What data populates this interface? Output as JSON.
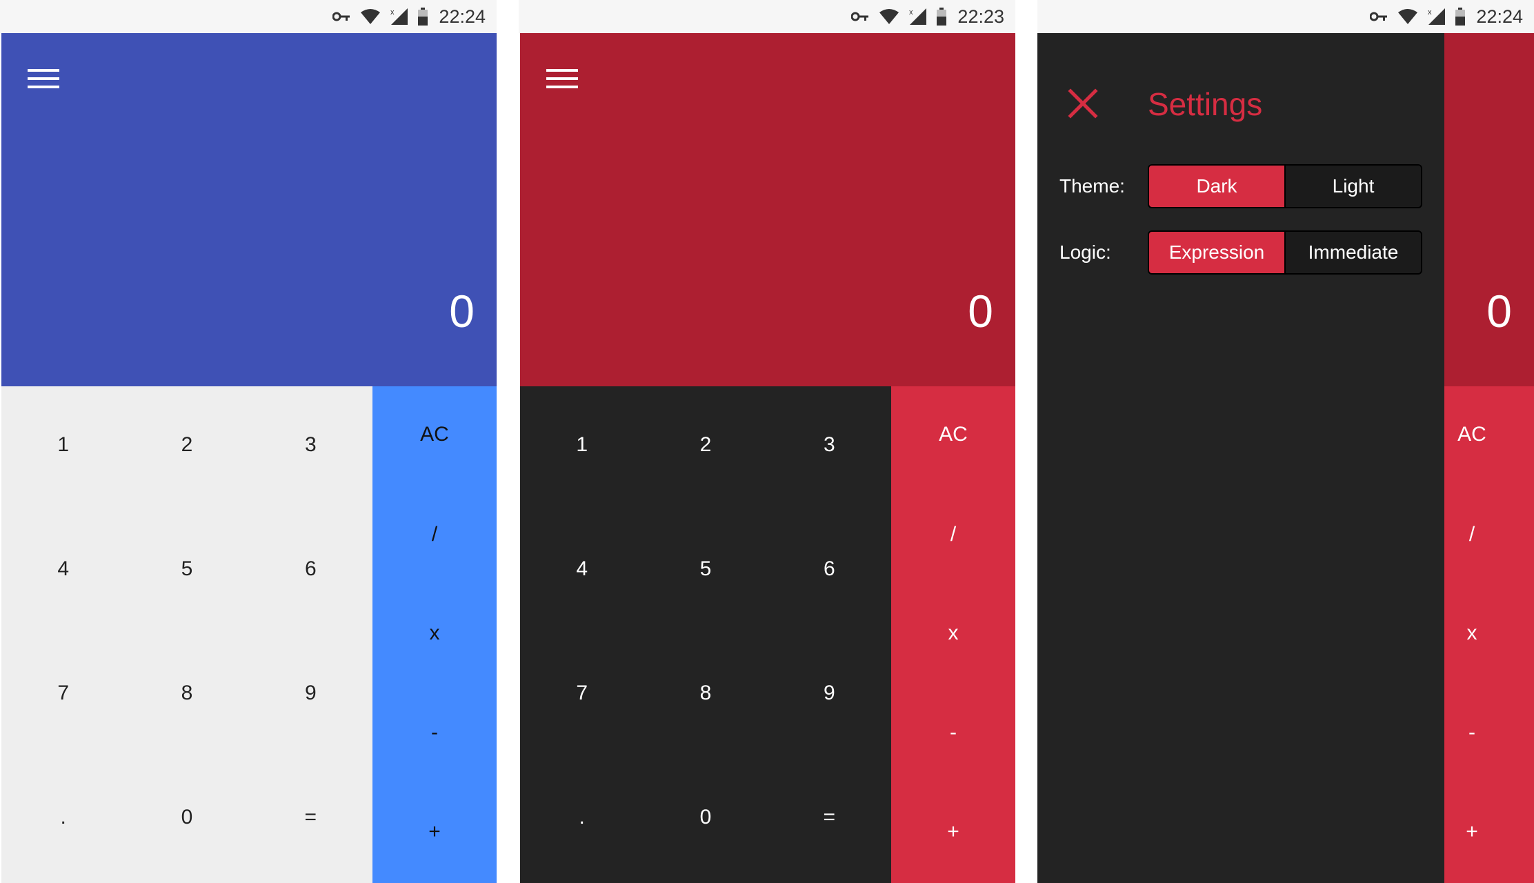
{
  "screens": [
    {
      "status_time": "22:24",
      "display_value": "0",
      "keys": [
        "1",
        "2",
        "3",
        "4",
        "5",
        "6",
        "7",
        "8",
        "9",
        ".",
        "0",
        "="
      ],
      "ops": [
        "AC",
        "/",
        "x",
        "-",
        "+"
      ]
    },
    {
      "status_time": "22:23",
      "display_value": "0",
      "keys": [
        "1",
        "2",
        "3",
        "4",
        "5",
        "6",
        "7",
        "8",
        "9",
        ".",
        "0",
        "="
      ],
      "ops": [
        "AC",
        "/",
        "x",
        "-",
        "+"
      ]
    },
    {
      "status_time": "22:24",
      "display_value": "0",
      "ops": [
        "AC",
        "/",
        "x",
        "-",
        "+"
      ],
      "settings": {
        "title": "Settings",
        "theme_label": "Theme:",
        "theme_options": [
          "Dark",
          "Light"
        ],
        "theme_selected": "Dark",
        "logic_label": "Logic:",
        "logic_options": [
          "Expression",
          "Immediate"
        ],
        "logic_selected": "Expression"
      }
    }
  ],
  "icons": {
    "status": [
      "vpn-key-icon",
      "wifi-icon",
      "signal-no-data-icon",
      "battery-icon"
    ],
    "menu": "menu-icon",
    "close": "close-icon"
  },
  "colors": {
    "light_display": "#3f51b5",
    "light_keypad": "#eeeeee",
    "light_ops": "#448aff",
    "dark_display": "#ad1f31",
    "dark_keypad": "#232323",
    "dark_ops": "#d62d42",
    "accent": "#d62d42"
  }
}
